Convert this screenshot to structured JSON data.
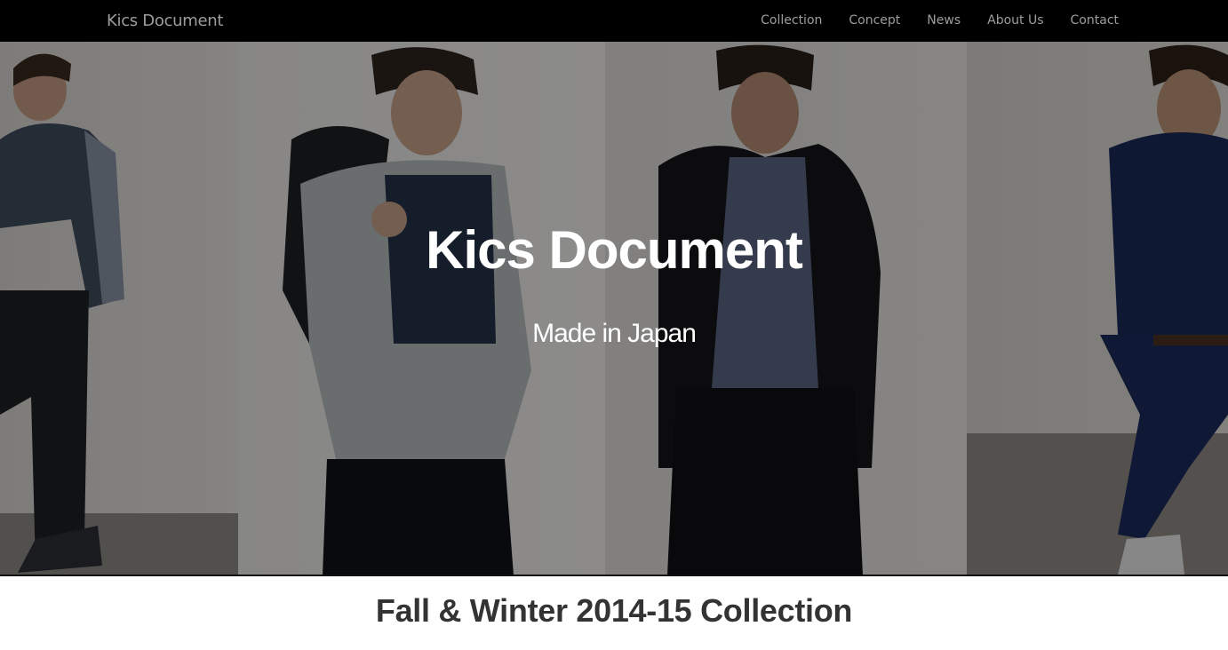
{
  "nav": {
    "brand": "Kics Document",
    "links": [
      "Collection",
      "Concept",
      "News",
      "About Us",
      "Contact"
    ]
  },
  "hero": {
    "title": "Kics Document",
    "subtitle": "Made in Japan"
  },
  "section": {
    "heading": "Fall & Winter 2014-15 Collection"
  },
  "colors": {
    "navbar_bg": "#000000",
    "nav_text": "#9d9d9d",
    "hero_text": "#ffffff",
    "heading_text": "#333333"
  }
}
